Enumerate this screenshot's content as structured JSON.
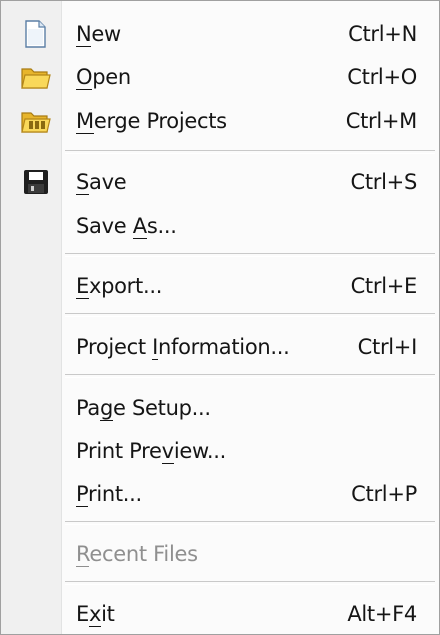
{
  "menu": {
    "new": {
      "pre": "",
      "ul": "N",
      "post": "ew",
      "shortcut": "Ctrl+N"
    },
    "open": {
      "pre": "",
      "ul": "O",
      "post": "pen",
      "shortcut": "Ctrl+O"
    },
    "merge": {
      "pre": "",
      "ul": "M",
      "post": "erge Projects",
      "shortcut": "Ctrl+M"
    },
    "save": {
      "pre": "",
      "ul": "S",
      "post": "ave",
      "shortcut": "Ctrl+S"
    },
    "save_as": {
      "pre": "Save ",
      "ul": "A",
      "post": "s..."
    },
    "export": {
      "pre": "",
      "ul": "E",
      "post": "xport...",
      "shortcut": "Ctrl+E"
    },
    "project_info": {
      "pre": "Project ",
      "ul": "I",
      "post": "nformation...",
      "shortcut": "Ctrl+I"
    },
    "page_setup": {
      "pre": "Pa",
      "ul": "g",
      "post": "e Setup..."
    },
    "print_preview": {
      "pre": "Print Pre",
      "ul": "v",
      "post": "iew..."
    },
    "print": {
      "pre": "",
      "ul": "P",
      "post": "rint...",
      "shortcut": "Ctrl+P"
    },
    "recent": {
      "pre": "",
      "ul": "R",
      "post": "ecent Files"
    },
    "exit": {
      "pre": "E",
      "ul": "x",
      "post": "it",
      "shortcut": "Alt+F4"
    }
  },
  "icons": {
    "new": "new-document-icon",
    "open": "open-folder-icon",
    "merge": "merge-projects-icon",
    "save": "save-disk-icon"
  },
  "colors": {
    "gutter": "#f0f0f0",
    "disabled_text": "#8f8f8f",
    "folder_yellow": "#f6d24a"
  }
}
